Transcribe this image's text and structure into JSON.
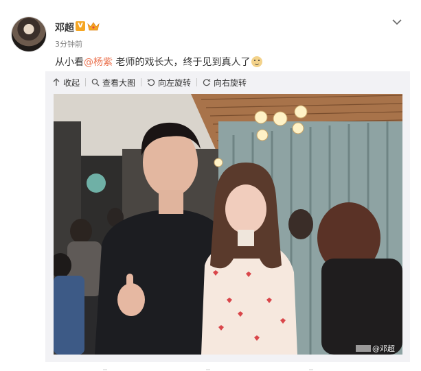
{
  "post": {
    "author": "邓超",
    "vip_badge": "V",
    "timestamp": "3分钟前",
    "text_before": "从小看",
    "mention": "@杨紫",
    "text_after": " 老师的戏长大，终于见到真人了",
    "emoji_icon": "doge-icon"
  },
  "toolbar": {
    "collapse_label": "收起",
    "view_large_label": "查看大图",
    "rotate_left_label": "向左旋转",
    "rotate_right_label": "向右旋转"
  },
  "photo": {
    "watermark": "@邓超"
  },
  "icons": {
    "collapse": "arrow-up-icon",
    "view_large": "magnifier-icon",
    "rotate_left": "rotate-left-icon",
    "rotate_right": "rotate-right-icon",
    "menu": "chevron-down-icon",
    "crown": "crown-icon"
  },
  "colors": {
    "mention": "#eb7350",
    "vip": "#f5a623",
    "panel_bg": "#f2f2f5"
  }
}
